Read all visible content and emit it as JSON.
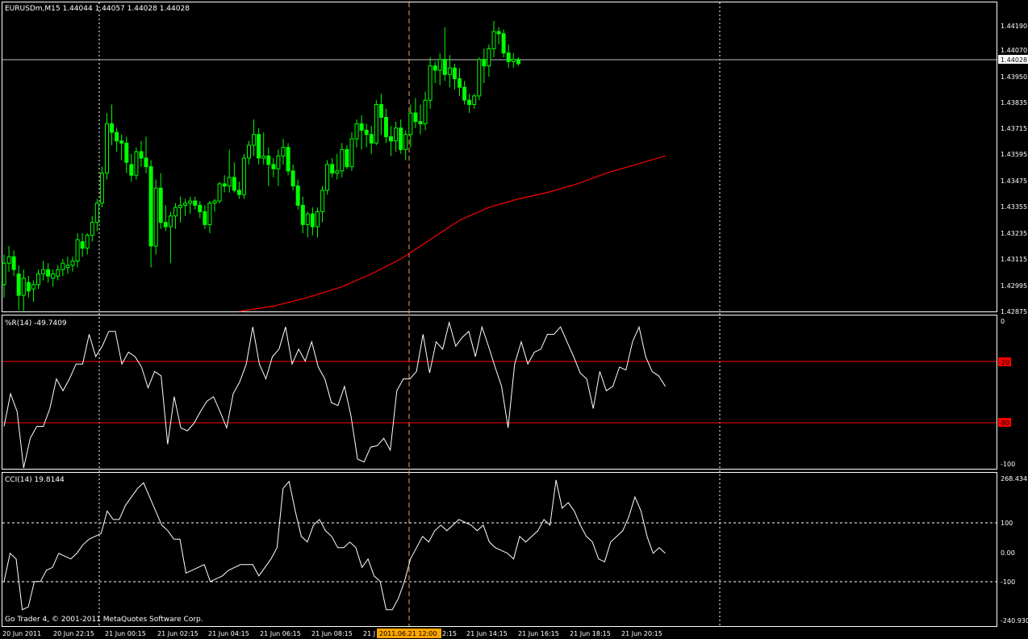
{
  "window": {
    "symbol": "EURUSDm,M15",
    "ohlc": "1.44044 1.44057 1.44028 1.44028",
    "copyright": "Go Trader 4, © 2001-2011 MetaQuotes Software Corp."
  },
  "colors": {
    "background": "#000000",
    "frame": "#ffffff",
    "bull_candle": "#00ff00",
    "bear_candle": "#000000",
    "moving_average": "#ff0000",
    "indicator_line": "#ffffff",
    "level_line": "#ff0000",
    "crosshair": "#f4a460",
    "time_highlight": "#ffa500"
  },
  "price_axis": {
    "ticks": [
      "1.44190",
      "1.44070",
      "1.43950",
      "1.43835",
      "1.43715",
      "1.43595",
      "1.43475",
      "1.43355",
      "1.43235",
      "1.43115",
      "1.42995",
      "1.42875"
    ],
    "current_price": "1.44028"
  },
  "time_axis": {
    "labels": [
      "20 Jun 2011",
      "20 Jun 22:15",
      "21 Jun 00:15",
      "21 Jun 02:15",
      "21 Jun 04:15",
      "21 Jun 06:15",
      "21 Jun 08:15",
      "21 J",
      "2:15",
      "21 Jun 14:15",
      "21 Jun 16:15",
      "21 Jun 18:15",
      "21 Jun 20:15"
    ],
    "crosshair_time": "2011.06.21 12:00"
  },
  "wpr_panel": {
    "title": "%R(14) -49.7409",
    "axis_ticks": [
      "0",
      "-100"
    ],
    "levels": [
      "-20",
      "-80"
    ]
  },
  "cci_panel": {
    "title": "CCI(14) 19.8144",
    "axis_ticks": [
      "268.434",
      "100",
      "0.00",
      "-100",
      "-240.930"
    ]
  },
  "chart_data": [
    {
      "type": "candlestick",
      "title": "EURUSDm,M15",
      "ylim": [
        1.42875,
        1.44252
      ],
      "candles": [
        [
          1.43,
          1.4314,
          1.4294,
          1.431
        ],
        [
          1.431,
          1.4318,
          1.4306,
          1.4313
        ],
        [
          1.4313,
          1.4316,
          1.4304,
          1.4307
        ],
        [
          1.4305,
          1.4309,
          1.4288,
          1.4295
        ],
        [
          1.4295,
          1.4307,
          1.4287,
          1.4303
        ],
        [
          1.4301,
          1.4304,
          1.4294,
          1.4297
        ],
        [
          1.4298,
          1.4302,
          1.4292,
          1.43
        ],
        [
          1.43,
          1.4307,
          1.4298,
          1.4305
        ],
        [
          1.4305,
          1.4311,
          1.4302,
          1.4307
        ],
        [
          1.4307,
          1.431,
          1.4301,
          1.4304
        ],
        [
          1.4303,
          1.4307,
          1.4299,
          1.4305
        ],
        [
          1.4304,
          1.4309,
          1.4302,
          1.4307
        ],
        [
          1.4307,
          1.4312,
          1.4304,
          1.431
        ],
        [
          1.4308,
          1.4313,
          1.4305,
          1.4309
        ],
        [
          1.4309,
          1.4313,
          1.4306,
          1.4311
        ],
        [
          1.4311,
          1.4324,
          1.4308,
          1.4321
        ],
        [
          1.432,
          1.4324,
          1.4313,
          1.4317
        ],
        [
          1.4317,
          1.4324,
          1.4314,
          1.4323
        ],
        [
          1.4323,
          1.4332,
          1.432,
          1.4329
        ],
        [
          1.4329,
          1.434,
          1.4325,
          1.4338
        ],
        [
          1.4338,
          1.4355,
          1.4336,
          1.4352
        ],
        [
          1.4352,
          1.438,
          1.4349,
          1.4375
        ],
        [
          1.4375,
          1.4384,
          1.4365,
          1.4371
        ],
        [
          1.4371,
          1.4373,
          1.4362,
          1.4367
        ],
        [
          1.4367,
          1.437,
          1.4358,
          1.4366
        ],
        [
          1.4366,
          1.4369,
          1.4352,
          1.4357
        ],
        [
          1.4356,
          1.4361,
          1.4348,
          1.4351
        ],
        [
          1.4351,
          1.4364,
          1.4349,
          1.4362
        ],
        [
          1.4362,
          1.4367,
          1.4355,
          1.4359
        ],
        [
          1.4359,
          1.4369,
          1.4352,
          1.4355
        ],
        [
          1.4355,
          1.4358,
          1.4308,
          1.4318
        ],
        [
          1.4318,
          1.4349,
          1.4314,
          1.4345
        ],
        [
          1.4345,
          1.4352,
          1.4326,
          1.4329
        ],
        [
          1.4329,
          1.4337,
          1.4325,
          1.4327
        ],
        [
          1.4327,
          1.4334,
          1.431,
          1.4332
        ],
        [
          1.4332,
          1.4338,
          1.4326,
          1.4336
        ],
        [
          1.4336,
          1.4341,
          1.4329,
          1.4337
        ],
        [
          1.4337,
          1.434,
          1.4332,
          1.4338
        ],
        [
          1.4338,
          1.4341,
          1.4333,
          1.4339
        ],
        [
          1.4339,
          1.4341,
          1.4335,
          1.4337
        ],
        [
          1.4337,
          1.4339,
          1.4331,
          1.4334
        ],
        [
          1.4334,
          1.4337,
          1.4326,
          1.4328
        ],
        [
          1.4328,
          1.4339,
          1.4324,
          1.4338
        ],
        [
          1.4338,
          1.434,
          1.4334,
          1.4339
        ],
        [
          1.4339,
          1.4348,
          1.4338,
          1.4347
        ],
        [
          1.4347,
          1.4351,
          1.4343,
          1.4346
        ],
        [
          1.4346,
          1.4363,
          1.4343,
          1.435
        ],
        [
          1.435,
          1.4357,
          1.4343,
          1.4344
        ],
        [
          1.4344,
          1.4348,
          1.434,
          1.4342
        ],
        [
          1.4342,
          1.4361,
          1.434,
          1.4359
        ],
        [
          1.4359,
          1.4367,
          1.4356,
          1.4365
        ],
        [
          1.4365,
          1.4377,
          1.436,
          1.437
        ],
        [
          1.437,
          1.4373,
          1.4356,
          1.4359
        ],
        [
          1.4359,
          1.4371,
          1.4356,
          1.436
        ],
        [
          1.436,
          1.4364,
          1.4346,
          1.4356
        ],
        [
          1.4356,
          1.4359,
          1.435,
          1.4354
        ],
        [
          1.4354,
          1.4363,
          1.4346,
          1.436
        ],
        [
          1.436,
          1.4368,
          1.4356,
          1.4364
        ],
        [
          1.4364,
          1.4366,
          1.4351,
          1.4353
        ],
        [
          1.4353,
          1.4356,
          1.4344,
          1.4346
        ],
        [
          1.4346,
          1.4349,
          1.4335,
          1.4337
        ],
        [
          1.4337,
          1.4341,
          1.4324,
          1.4328
        ],
        [
          1.4328,
          1.4334,
          1.4322,
          1.4333
        ],
        [
          1.4333,
          1.4336,
          1.4323,
          1.4327
        ],
        [
          1.4327,
          1.4336,
          1.4322,
          1.4334
        ],
        [
          1.4334,
          1.4346,
          1.4329,
          1.4344
        ],
        [
          1.4344,
          1.4358,
          1.4342,
          1.4356
        ],
        [
          1.4356,
          1.4359,
          1.435,
          1.4352
        ],
        [
          1.4352,
          1.4361,
          1.4349,
          1.4353
        ],
        [
          1.4353,
          1.4366,
          1.435,
          1.4363
        ],
        [
          1.4363,
          1.4365,
          1.4354,
          1.4355
        ],
        [
          1.4355,
          1.4371,
          1.4353,
          1.4368
        ],
        [
          1.4368,
          1.4377,
          1.4364,
          1.4375
        ],
        [
          1.4375,
          1.4379,
          1.4363,
          1.4372
        ],
        [
          1.4372,
          1.4375,
          1.4364,
          1.437
        ],
        [
          1.437,
          1.4374,
          1.4361,
          1.4366
        ],
        [
          1.4366,
          1.4386,
          1.4365,
          1.4384
        ],
        [
          1.4384,
          1.4389,
          1.437,
          1.4378
        ],
        [
          1.4378,
          1.4382,
          1.4366,
          1.4369
        ],
        [
          1.4369,
          1.4374,
          1.436,
          1.4367
        ],
        [
          1.4367,
          1.4376,
          1.4362,
          1.4373
        ],
        [
          1.4373,
          1.4377,
          1.4361,
          1.4363
        ],
        [
          1.4363,
          1.4372,
          1.4358,
          1.437
        ],
        [
          1.437,
          1.4384,
          1.4364,
          1.438
        ],
        [
          1.438,
          1.4387,
          1.4373,
          1.4376
        ],
        [
          1.4376,
          1.4384,
          1.437,
          1.4375
        ],
        [
          1.4375,
          1.439,
          1.4372,
          1.4386
        ],
        [
          1.4386,
          1.4406,
          1.4382,
          1.4402
        ],
        [
          1.4402,
          1.4404,
          1.4394,
          1.44
        ],
        [
          1.44,
          1.4408,
          1.4393,
          1.4405
        ],
        [
          1.4405,
          1.442,
          1.4395,
          1.4398
        ],
        [
          1.4398,
          1.4407,
          1.4392,
          1.4401
        ],
        [
          1.4401,
          1.4403,
          1.4391,
          1.4396
        ],
        [
          1.4396,
          1.4401,
          1.4388,
          1.4392
        ],
        [
          1.4392,
          1.4395,
          1.4384,
          1.4386
        ],
        [
          1.4386,
          1.4389,
          1.438,
          1.4384
        ],
        [
          1.4384,
          1.4389,
          1.4382,
          1.4388
        ],
        [
          1.4388,
          1.4406,
          1.4386,
          1.4405
        ],
        [
          1.4405,
          1.441,
          1.4394,
          1.4402
        ],
        [
          1.4402,
          1.4412,
          1.4397,
          1.441
        ],
        [
          1.441,
          1.4423,
          1.4406,
          1.4418
        ],
        [
          1.4418,
          1.442,
          1.4412,
          1.4417
        ],
        [
          1.4417,
          1.4419,
          1.4406,
          1.4408
        ],
        [
          1.4408,
          1.4412,
          1.4401,
          1.4404
        ],
        [
          1.4404,
          1.4408,
          1.4401,
          1.4405
        ],
        [
          1.4405,
          1.4406,
          1.4402,
          1.4403
        ]
      ],
      "moving_average": [
        [
          48,
          1.42875
        ],
        [
          55,
          1.429
        ],
        [
          62,
          1.4294
        ],
        [
          69,
          1.4299
        ],
        [
          75,
          1.4305
        ],
        [
          81,
          1.4312
        ],
        [
          87,
          1.4321
        ],
        [
          93,
          1.433
        ],
        [
          99,
          1.4336
        ],
        [
          105,
          1.434
        ],
        [
          111,
          1.4343
        ],
        [
          117,
          1.4347
        ],
        [
          123,
          1.4352
        ],
        [
          129,
          1.4356
        ],
        [
          135,
          1.436
        ]
      ]
    },
    {
      "type": "line",
      "title": "%R(14) -49.7409",
      "ylim": [
        -100,
        0
      ],
      "levels": [
        -20,
        -80
      ],
      "values": [
        -72,
        -50,
        -62,
        -100,
        -80,
        -72,
        -72,
        -60,
        -40,
        -48,
        -40,
        -30,
        -30,
        -10,
        -25,
        -18,
        -8,
        -8,
        -30,
        -22,
        -25,
        -32,
        -46,
        -35,
        -38,
        -84,
        -52,
        -73,
        -75,
        -70,
        -62,
        -55,
        -52,
        -62,
        -73,
        -50,
        -42,
        -30,
        -5,
        -30,
        -40,
        -25,
        -20,
        -5,
        -30,
        -20,
        -28,
        -15,
        -32,
        -40,
        -56,
        -58,
        -45,
        -65,
        -94,
        -96,
        -86,
        -85,
        -80,
        -88,
        -48,
        -40,
        -40,
        -35,
        -10,
        -36,
        -15,
        -20,
        -2,
        -18,
        -12,
        -8,
        -25,
        -5,
        -18,
        -32,
        -45,
        -73,
        -30,
        -15,
        -30,
        -22,
        -20,
        -10,
        -10,
        -5,
        -15,
        -25,
        -36,
        -40,
        -60,
        -35,
        -48,
        -45,
        -32,
        -34,
        -15,
        -5,
        -25,
        -35,
        -38,
        -45
      ],
      "x_start": 0,
      "x_end": 135
    },
    {
      "type": "line",
      "title": "CCI(14) 19.8144",
      "ylim": [
        -240.93,
        268.434
      ],
      "levels": [
        100,
        -100
      ],
      "values": [
        -100,
        0,
        -20,
        -200,
        -190,
        -100,
        -100,
        -60,
        -50,
        0,
        -10,
        -20,
        0,
        30,
        50,
        60,
        70,
        150,
        120,
        120,
        170,
        200,
        230,
        250,
        200,
        150,
        100,
        80,
        50,
        50,
        -70,
        -60,
        -50,
        -40,
        -100,
        -90,
        -80,
        -60,
        -50,
        -40,
        -40,
        -40,
        -80,
        -50,
        -20,
        20,
        230,
        255,
        150,
        60,
        40,
        100,
        120,
        80,
        60,
        20,
        20,
        40,
        20,
        -50,
        -20,
        -80,
        -100,
        -200,
        -200,
        -160,
        -100,
        -20,
        20,
        60,
        40,
        80,
        100,
        80,
        100,
        120,
        110,
        100,
        80,
        100,
        40,
        20,
        10,
        0,
        -20,
        60,
        40,
        60,
        80,
        120,
        100,
        260,
        160,
        180,
        150,
        100,
        60,
        40,
        -20,
        -30,
        40,
        60,
        80,
        130,
        200,
        150,
        60,
        0,
        20,
        0
      ],
      "x_start": 0,
      "x_end": 135
    }
  ]
}
